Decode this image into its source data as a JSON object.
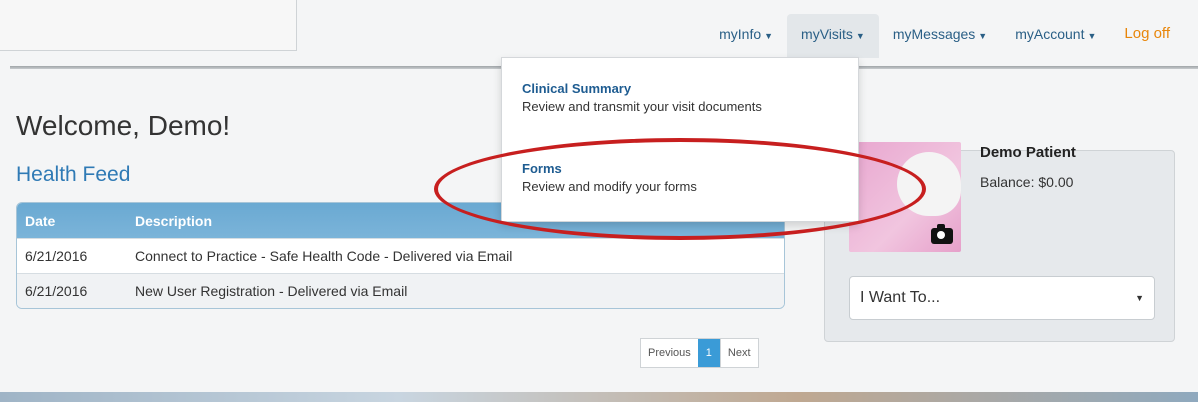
{
  "nav": {
    "myinfo": "myInfo",
    "myvisits": "myVisits",
    "mymessages": "myMessages",
    "myaccount": "myAccount",
    "logoff": "Log off"
  },
  "dropdown": {
    "clinical_title": "Clinical Summary",
    "clinical_desc": "Review and transmit your visit documents",
    "forms_title": "Forms",
    "forms_desc": "Review and modify your forms"
  },
  "page": {
    "welcome": "Welcome, Demo!",
    "health_feed": "Health Feed"
  },
  "feed": {
    "headers": {
      "date": "Date",
      "description": "Description"
    },
    "rows": [
      {
        "date": "6/21/2016",
        "description": "Connect to Practice - Safe Health Code - Delivered via Email"
      },
      {
        "date": "6/21/2016",
        "description": "New User Registration - Delivered via Email"
      }
    ]
  },
  "pager": {
    "previous": "Previous",
    "page": "1",
    "next": "Next"
  },
  "profile": {
    "name": "Demo Patient",
    "balance": "Balance: $0.00",
    "select_value": "I Want To..."
  },
  "colors": {
    "accent": "#2f7ab5",
    "logoff": "#e8860a",
    "callout": "#c71f1f"
  },
  "icons": {
    "caret": "caret-down-icon",
    "camera": "camera-icon"
  }
}
